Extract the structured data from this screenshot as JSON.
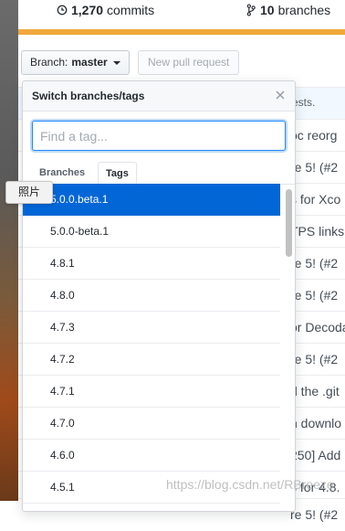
{
  "stats": {
    "commits_count": "1,270",
    "commits_label": "commits",
    "branches_count": "10",
    "branches_label": "branches",
    "language_bar_color": "#f1a83b"
  },
  "toolbar": {
    "branch_label": "Branch:",
    "branch_value": "master",
    "new_pull_request": "New pull request"
  },
  "commit_rows": [
    "ests.",
    "oc reorg",
    "re 5! (#2",
    "s for Xco",
    "TPS links",
    "re 5! (#2",
    "re 5! (#2",
    "or Decoda",
    "re 5! (#2",
    "d the .git",
    "n downlo",
    "250] Add",
    "s for 4.8.",
    "re 5! (#2"
  ],
  "dropdown": {
    "title": "Switch branches/tags",
    "filter_placeholder": "Find a tag...",
    "tabs": [
      "Branches",
      "Tags"
    ],
    "active_tab": "Tags",
    "tags": [
      "5.0.0.beta.1",
      "5.0.0-beta.1",
      "4.8.1",
      "4.8.0",
      "4.7.3",
      "4.7.2",
      "4.7.1",
      "4.7.0",
      "4.6.0",
      "4.5.1"
    ],
    "selected_tag": "5.0.0.beta.1",
    "selected_color": "#0366d6"
  },
  "tooltip": {
    "text": "照片"
  },
  "watermark": "https://blog.csdn.net/RBreeze"
}
